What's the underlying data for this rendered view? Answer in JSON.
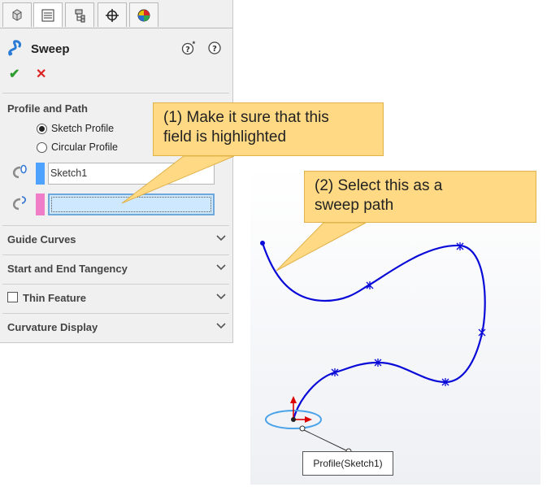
{
  "panel": {
    "title": "Sweep",
    "sections": {
      "profile_and_path": "Profile and Path",
      "guide_curves": "Guide Curves",
      "start_end_tangency": "Start and End Tangency",
      "thin_feature": "Thin Feature",
      "curvature_display": "Curvature Display"
    },
    "radio": {
      "sketch_profile": "Sketch Profile",
      "circular_profile": "Circular Profile",
      "selected": "sketch_profile"
    },
    "profile_value": "Sketch1",
    "path_value": "",
    "thin_feature_checked": false,
    "colors": {
      "profile_swatch": "#4da3ff",
      "path_swatch": "#f07dc8",
      "ok": "#2e9c2e",
      "cancel": "#dd2222"
    }
  },
  "graphics": {
    "profile_tag": "Profile(Sketch1)",
    "path_color": "#0a0ad8",
    "profile_color": "#4aa3e8"
  },
  "callouts": {
    "c1_line1": "(1) Make it sure that this",
    "c1_line2": "field is highlighted",
    "c2_line1": "(2) Select this as a",
    "c2_line2": "sweep path",
    "fill": "#ffd984"
  }
}
